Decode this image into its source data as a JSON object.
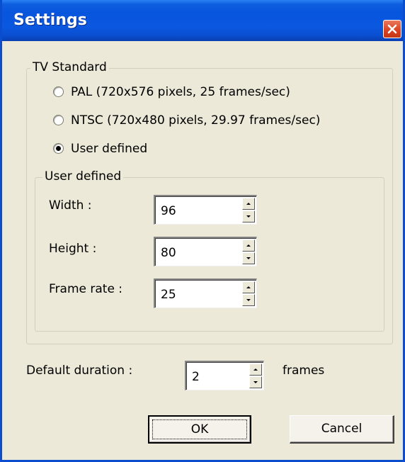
{
  "window": {
    "title": "Settings"
  },
  "tv_standard": {
    "label": "TV Standard",
    "options": [
      {
        "label": "PAL (720x576 pixels, 25 frames/sec)",
        "selected": false
      },
      {
        "label": "NTSC (720x480 pixels, 29.97 frames/sec)",
        "selected": false
      },
      {
        "label": "User defined",
        "selected": true
      }
    ]
  },
  "user_defined": {
    "label": "User defined",
    "width": {
      "label": "Width :",
      "value": "96"
    },
    "height": {
      "label": "Height :",
      "value": "80"
    },
    "frame_rate": {
      "label": "Frame rate :",
      "value": "25"
    }
  },
  "duration": {
    "label": "Default duration :",
    "value": "2",
    "unit": "frames"
  },
  "buttons": {
    "ok": "OK",
    "cancel": "Cancel"
  },
  "colors": {
    "title_bar": "#0855dd",
    "dialog_bg": "#ece9d8",
    "close_button": "#d8411f"
  },
  "icons": {
    "close": "close-icon",
    "spin_up": "spin-up-icon",
    "spin_down": "spin-down-icon"
  }
}
